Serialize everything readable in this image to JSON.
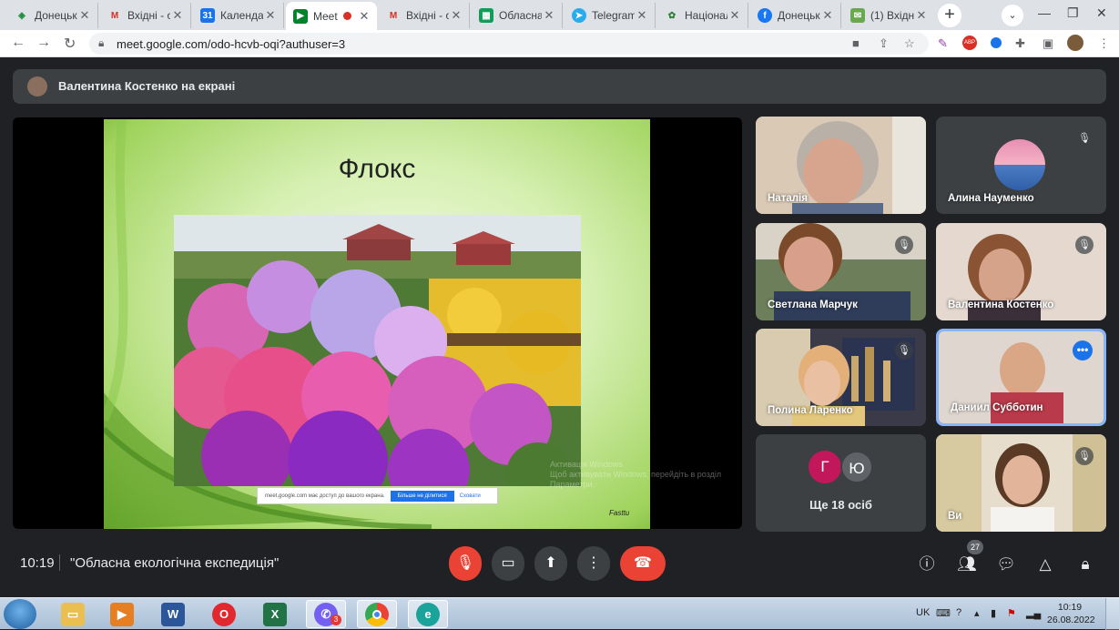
{
  "browser": {
    "tabs": [
      {
        "title": "Донецьк",
        "favicon": "shield-icon",
        "color": "#1e8e3e"
      },
      {
        "title": "Вхідні - о",
        "favicon": "gmail-icon",
        "color": "#d93025"
      },
      {
        "title": "Календар",
        "favicon": "calendar-icon",
        "color": "#1a73e8"
      },
      {
        "title": "Meet",
        "favicon": "meet-icon",
        "color": "#00832d",
        "active": true
      },
      {
        "title": "Вхідні - о",
        "favicon": "gmail-icon",
        "color": "#d93025"
      },
      {
        "title": "Обласна",
        "favicon": "sheets-icon",
        "color": "#0f9d58"
      },
      {
        "title": "Telegram",
        "favicon": "telegram-icon",
        "color": "#2aabee"
      },
      {
        "title": "Національ",
        "favicon": "emblem-icon",
        "color": "#2e7d32"
      },
      {
        "title": "Донецьк",
        "favicon": "facebook-icon",
        "color": "#1877f2"
      },
      {
        "title": "(1) Вхідн",
        "favicon": "mail-icon",
        "color": "#6aa84f"
      }
    ],
    "url": "meet.google.com/odo-hcvb-oqi?authuser=3"
  },
  "meet": {
    "presenting_banner": "Валентина Костенко на екрані",
    "slide": {
      "title": "Флокс",
      "notice_text": "meet.google.com має доступ до вашого екрана.",
      "notice_stop": "Більше не ділитися",
      "notice_hide": "Сховати",
      "activation_line1": "Активація Windows",
      "activation_line2": "Щоб активувати Windows, перейдіть в розділ",
      "activation_line3": "Параметри.",
      "corner_logo": "Fasttu"
    },
    "participants": [
      {
        "name": "Наталія",
        "muted": false
      },
      {
        "name": "Алина Науменко",
        "muted": true
      },
      {
        "name": "Светлана Марчук",
        "muted": true
      },
      {
        "name": "Валентина Костенко",
        "muted": true
      },
      {
        "name": "Полина Ларенко",
        "muted": true
      },
      {
        "name": "Даниил Субботин",
        "muted": false,
        "selected": true
      },
      {
        "name": "Ще 18 осіб",
        "avatars": [
          "Г",
          "Ю"
        ]
      },
      {
        "name": "Ви",
        "muted": true
      }
    ],
    "bottom": {
      "time": "10:19",
      "meeting_title": "\"Обласна екологічна експедиція\"",
      "people_count": "27"
    }
  },
  "taskbar": {
    "lang": "UK",
    "time": "10:19",
    "date": "26.08.2022",
    "viber_badge": "3"
  }
}
